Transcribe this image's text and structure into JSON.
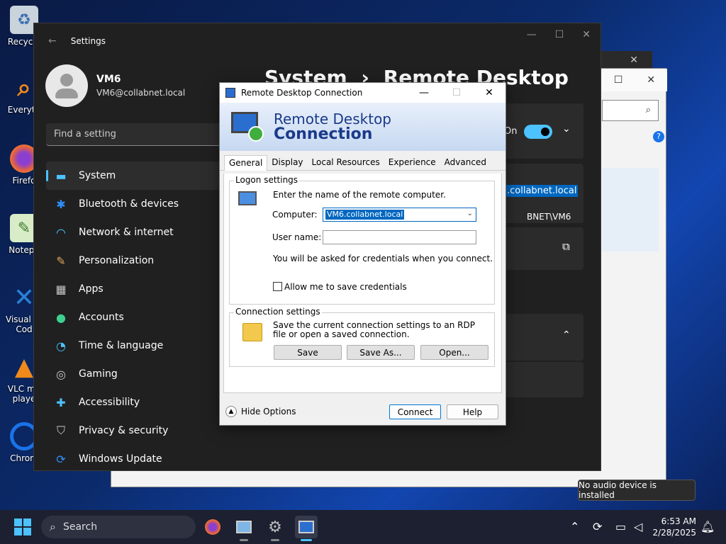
{
  "desktop": {
    "icons": [
      {
        "label": "Recycle",
        "glyph": "♻",
        "color": "#d0d8e0"
      },
      {
        "label": "Everyth",
        "glyph": "⌕",
        "color": "#f28a1a"
      },
      {
        "label": "Firefo",
        "glyph": "●",
        "color": "#e8623a"
      },
      {
        "label": "Notepa",
        "glyph": "✎",
        "color": "#6ab04c"
      },
      {
        "label": "Visual St",
        "label2": "Cod",
        "glyph": "✕",
        "color": "#2a7fd4"
      },
      {
        "label": "VLC me",
        "label2": "playe",
        "glyph": "▲",
        "color": "#f08a1a"
      },
      {
        "label": "Chrom",
        "glyph": "◉",
        "color": "#1a73e8"
      }
    ]
  },
  "settings": {
    "title": "Settings",
    "user_name": "VM6",
    "user_email": "VM6@collabnet.local",
    "search_placeholder": "Find a setting",
    "heading_part1": "System",
    "heading_sep": "›",
    "heading_part2": "Remote Desktop",
    "toggle_label": "On",
    "computer_name_selected": ".collabnet.local",
    "user_account_text": "BNET\\VM6",
    "nav": [
      {
        "label": "System",
        "icon": "▭",
        "color": "#4cc2ff"
      },
      {
        "label": "Bluetooth & devices",
        "icon": "✱",
        "color": "#2f8fff"
      },
      {
        "label": "Network & internet",
        "icon": "◠",
        "color": "#4cc2ff"
      },
      {
        "label": "Personalization",
        "icon": "✎",
        "color": "#e2a65a"
      },
      {
        "label": "Apps",
        "icon": "▦",
        "color": "#c8c8c8"
      },
      {
        "label": "Accounts",
        "icon": "●",
        "color": "#3ecf8e"
      },
      {
        "label": "Time & language",
        "icon": "◔",
        "color": "#4cc2ff"
      },
      {
        "label": "Gaming",
        "icon": "◎",
        "color": "#c8c8c8"
      },
      {
        "label": "Accessibility",
        "icon": "✚",
        "color": "#4cc2ff"
      },
      {
        "label": "Privacy & security",
        "icon": "⛉",
        "color": "#c8c8c8"
      },
      {
        "label": "Windows Update",
        "icon": "⟳",
        "color": "#2f8fff"
      }
    ]
  },
  "rdp": {
    "title": "Remote Desktop Connection",
    "banner_line1": "Remote Desktop",
    "banner_line2": "Connection",
    "tabs": [
      "General",
      "Display",
      "Local Resources",
      "Experience",
      "Advanced"
    ],
    "logon_title": "Logon settings",
    "logon_intro": "Enter the name of the remote computer.",
    "computer_label": "Computer:",
    "computer_value": "VM6.collabnet.local",
    "username_label": "User name:",
    "username_value": "",
    "credentials_note": "You will be asked for credentials when you connect.",
    "allow_save_label": "Allow me to save credentials",
    "connection_title": "Connection settings",
    "connection_desc": "Save the current connection settings to an RDP file or open a saved connection.",
    "save_label": "Save",
    "save_as_label": "Save As...",
    "open_label": "Open...",
    "hide_options_label": "Hide Options",
    "connect_label": "Connect",
    "help_label": "Help"
  },
  "taskbar": {
    "search_label": "Search",
    "time": "6:53 AM",
    "date": "2/28/2025",
    "tooltip": "No audio device is installed"
  }
}
